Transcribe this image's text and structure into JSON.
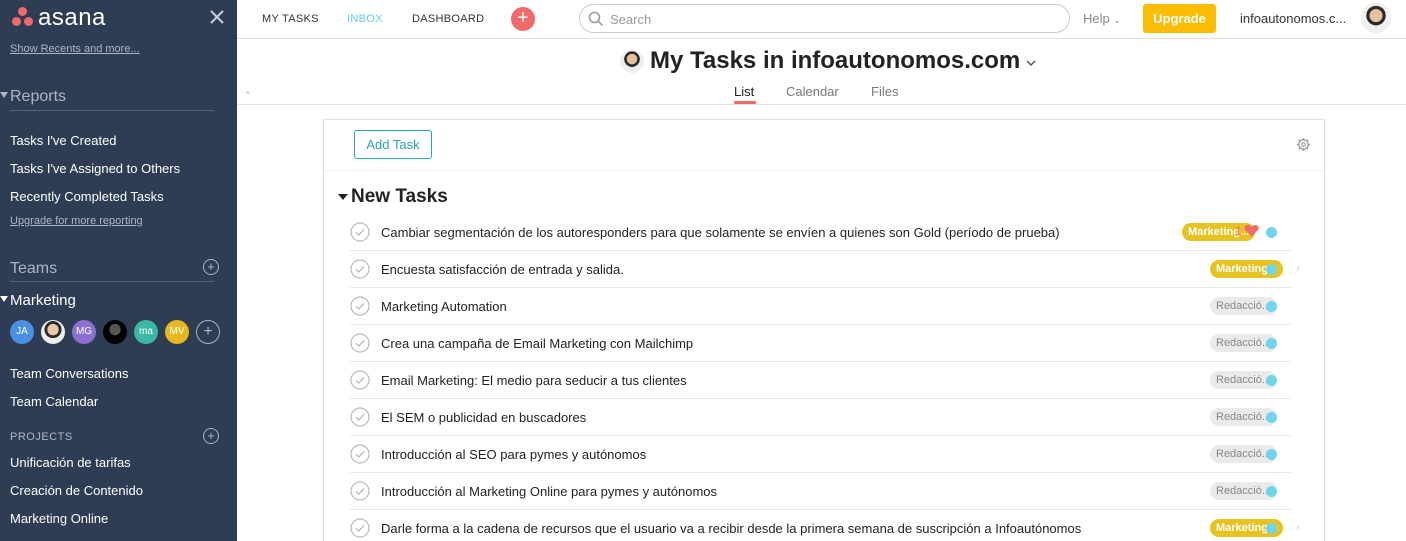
{
  "sidebar": {
    "brand": "asana",
    "recents_link": "Show Recents and more...",
    "reports_heading": "Reports",
    "reports": [
      "Tasks I've Created",
      "Tasks I've Assigned to Others",
      "Recently Completed Tasks"
    ],
    "upgrade_reporting": "Upgrade for more reporting",
    "teams_heading": "Teams",
    "team_name": "Marketing",
    "members": [
      {
        "initials": "JA",
        "color": "#4a90e2"
      },
      {
        "initials": "",
        "color": "photo"
      },
      {
        "initials": "MG",
        "color": "#8d6fd3"
      },
      {
        "initials": "",
        "color": "dark"
      },
      {
        "initials": "ma",
        "color": "#3bb7a4"
      },
      {
        "initials": "MV",
        "color": "#e6b81f"
      }
    ],
    "team_links": [
      "Team Conversations",
      "Team Calendar"
    ],
    "projects_heading": "PROJECTS",
    "projects": [
      "Unificación de tarifas",
      "Creación de Contenido",
      "Marketing Online"
    ]
  },
  "topbar": {
    "nav": [
      "MY TASKS",
      "INBOX",
      "DASHBOARD"
    ],
    "active_nav": "INBOX",
    "search_placeholder": "Search",
    "help": "Help",
    "upgrade": "Upgrade",
    "org": "infoautonomos.c..."
  },
  "header": {
    "title": "My Tasks in infoautonomos.com",
    "tabs": [
      "List",
      "Calendar",
      "Files"
    ],
    "active_tab": "List"
  },
  "main": {
    "add_task": "Add Task",
    "section": "New Tasks",
    "tasks": [
      {
        "name": "Cambiar segmentación de los autoresponders para que solamente se envíen a quienes son Gold (período de prueba)",
        "tag": "Marketing...",
        "tag_type": "mkt",
        "likes": "1"
      },
      {
        "name": " Encuesta satisfacción de entrada y salida.",
        "tag": "Marketing...",
        "tag_type": "mkt"
      },
      {
        "name": "Marketing Automation",
        "tag": "Redacció...",
        "tag_type": "red"
      },
      {
        "name": "Crea una campaña de Email Marketing con Mailchimp",
        "tag": "Redacció...",
        "tag_type": "red"
      },
      {
        "name": "Email Marketing: El medio para seducir a tus clientes",
        "tag": "Redacció...",
        "tag_type": "red"
      },
      {
        "name": "El SEM o publicidad en buscadores",
        "tag": "Redacció...",
        "tag_type": "red"
      },
      {
        "name": "Introducción al SEO para pymes y autónomos",
        "tag": "Redacció...",
        "tag_type": "red"
      },
      {
        "name": "Introducción al Marketing Online para pymes y autónomos",
        "tag": "Redacció...",
        "tag_type": "red"
      },
      {
        "name": "Darle forma a la cadena de recursos que el usuario va a recibir desde la primera semana de suscripción a Infoautónomos",
        "tag": "Marketing...",
        "tag_type": "mkt"
      }
    ]
  },
  "colors": {
    "brand": "#f06a6a",
    "sidebar": "#2e3c54",
    "accent": "#25a5b7",
    "upgrade": "#fcbd01",
    "marketing_tag": "#e8c221",
    "project_dot": "#6fd5ea"
  }
}
